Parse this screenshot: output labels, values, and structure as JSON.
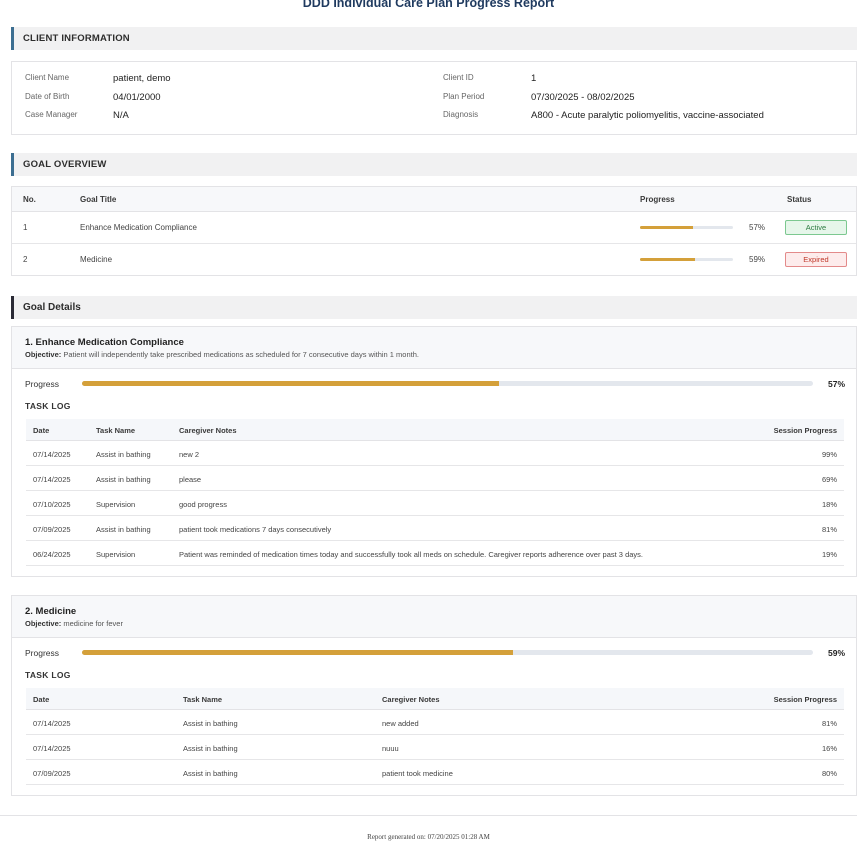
{
  "title": "DDD Individual Care Plan Progress Report",
  "client_info": {
    "header": "CLIENT INFORMATION",
    "client_name_label": "Client Name",
    "client_name": "patient, demo",
    "dob_label": "Date of Birth",
    "dob": "04/01/2000",
    "case_manager_label": "Case Manager",
    "case_manager": "N/A",
    "client_id_label": "Client ID",
    "client_id": "1",
    "plan_period_label": "Plan Period",
    "plan_period": "07/30/2025 - 08/02/2025",
    "diagnosis_label": "Diagnosis",
    "diagnosis": "A800 - Acute paralytic poliomyelitis, vaccine-associated"
  },
  "goal_overview": {
    "header": "GOAL OVERVIEW",
    "columns": [
      "No.",
      "Goal Title",
      "Progress",
      "Status"
    ],
    "rows": [
      {
        "no": "1",
        "title": "Enhance Medication Compliance",
        "progress": 57,
        "progress_label": "57%",
        "status": "Active"
      },
      {
        "no": "2",
        "title": "Medicine",
        "progress": 59,
        "progress_label": "59%",
        "status": "Expired"
      }
    ]
  },
  "goal_details": {
    "header": "Goal Details",
    "progress_label": "Progress",
    "objective_label": "Objective:",
    "task_log_label": "TASK LOG",
    "columns": [
      "Date",
      "Task Name",
      "Caregiver Notes",
      "Session Progress"
    ],
    "goals": [
      {
        "title": "1. Enhance Medication Compliance",
        "objective": "Patient will independently take prescribed medications as scheduled for 7 consecutive days within 1 month.",
        "progress": 57,
        "progress_label": "57%",
        "tasks": [
          {
            "date": "07/14/2025",
            "task": "Assist in bathing",
            "notes": "new 2",
            "session": "99%"
          },
          {
            "date": "07/14/2025",
            "task": "Assist in bathing",
            "notes": "please",
            "session": "69%"
          },
          {
            "date": "07/10/2025",
            "task": "Supervision",
            "notes": "good progress",
            "session": "18%"
          },
          {
            "date": "07/09/2025",
            "task": "Assist in bathing",
            "notes": "patient took medications 7 days consecutively",
            "session": "81%"
          },
          {
            "date": "06/24/2025",
            "task": "Supervision",
            "notes": "Patient was reminded of medication times today and successfully took all meds on schedule. Caregiver reports adherence over past 3 days.",
            "session": "19%"
          }
        ]
      },
      {
        "title": "2. Medicine",
        "objective": "medicine for fever",
        "progress": 59,
        "progress_label": "59%",
        "tasks": [
          {
            "date": "07/14/2025",
            "task": "Assist in bathing",
            "notes": "new added",
            "session": "81%"
          },
          {
            "date": "07/14/2025",
            "task": "Assist in bathing",
            "notes": "nuuu",
            "session": "16%"
          },
          {
            "date": "07/09/2025",
            "task": "Assist in bathing",
            "notes": "patient took medicine",
            "session": "80%"
          }
        ]
      }
    ]
  },
  "footer": "Report generated on: 07/20/2025 01:28 AM"
}
